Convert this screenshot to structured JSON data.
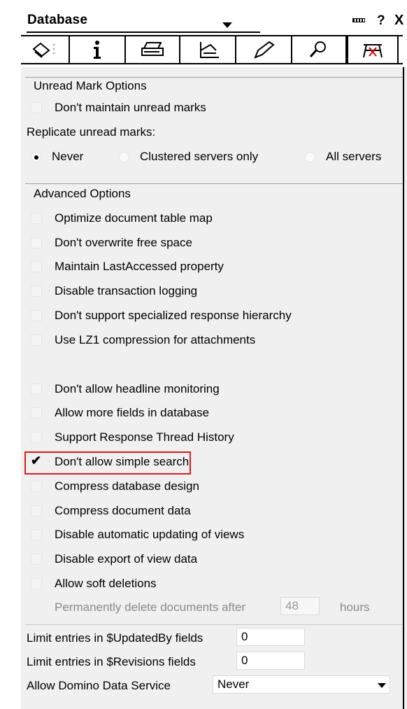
{
  "title": {
    "text": "Database",
    "help": "?",
    "close": "X"
  },
  "tabs": [
    {
      "icon": "properties-icon"
    },
    {
      "icon": "info-icon"
    },
    {
      "icon": "printer-icon"
    },
    {
      "icon": "design-icon"
    },
    {
      "icon": "launch-icon"
    },
    {
      "icon": "search-icon"
    },
    {
      "icon": "advanced-icon",
      "active": true
    }
  ],
  "unread": {
    "heading": "Unread Mark Options",
    "dont_maintain": "Don't maintain unread marks",
    "replicate_label": "Replicate unread marks:",
    "radios": [
      "Never",
      "Clustered servers only",
      "All servers"
    ]
  },
  "advanced": {
    "heading": "Advanced Options",
    "group1": [
      "Optimize document table map",
      "Don't overwrite free space",
      "Maintain LastAccessed property",
      "Disable transaction logging",
      "Don't support specialized response hierarchy",
      "Use LZ1 compression for attachments"
    ],
    "group2": [
      "Don't allow headline monitoring",
      "Allow more fields in database",
      "Support Response Thread History",
      "Don't allow simple search",
      "Compress database design",
      "Compress document data",
      "Disable automatic updating of views",
      "Disable export of view data",
      "Allow soft deletions"
    ],
    "checked_item": "Don't allow simple search",
    "permanent_delete_label": "Permanently delete documents after",
    "permanent_delete_value": "48",
    "permanent_delete_unit": "hours"
  },
  "limits": {
    "updatedby_label": "Limit entries in $UpdatedBy fields",
    "updatedby_value": "0",
    "revisions_label": "Limit entries in $Revisions fields",
    "revisions_value": "0",
    "dds_label": "Allow Domino Data Service",
    "dds_value": "Never"
  },
  "colors": {
    "highlight": "#e0191f",
    "panel": "#f0f0f0"
  }
}
